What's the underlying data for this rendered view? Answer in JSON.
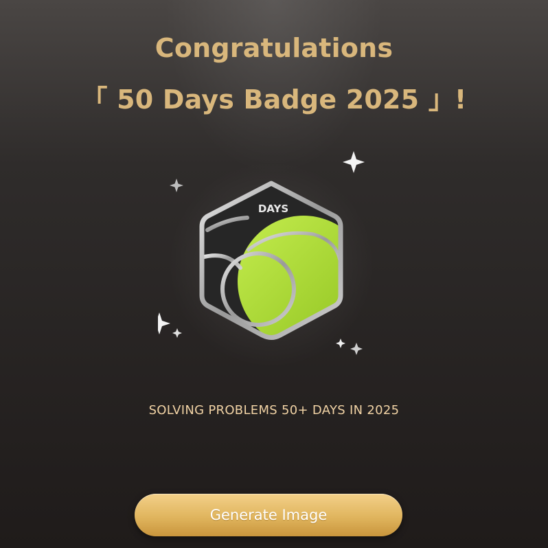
{
  "header": {
    "line1": "Congratulations",
    "line2": "「 50 Days Badge 2025 」!"
  },
  "badge": {
    "label": "DAYS",
    "accent_color": "#a6d632",
    "frame_color": "#b9b9b9"
  },
  "subtitle": "SOLVING PROBLEMS 50+ DAYS IN 2025",
  "button": {
    "label": "Generate Image"
  },
  "colors": {
    "title": "#d9b77c",
    "subtitle": "#f1d3a5",
    "button_gold": "#e0b55e"
  }
}
